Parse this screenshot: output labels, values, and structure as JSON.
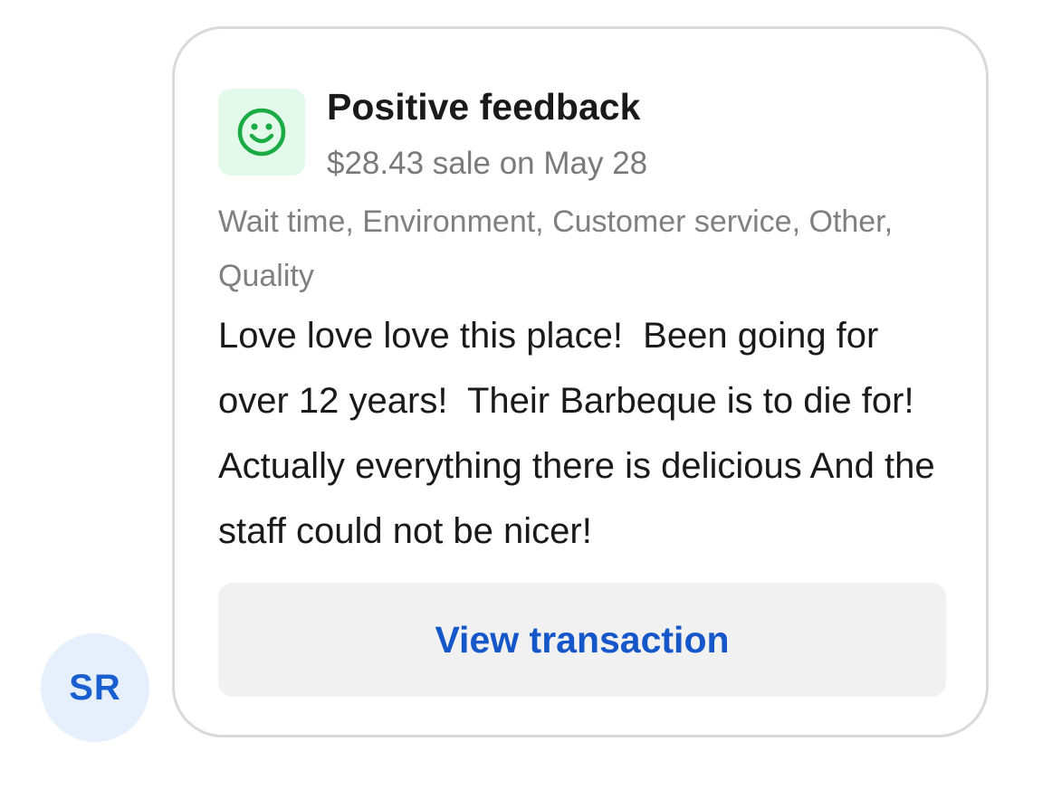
{
  "avatar": {
    "initials": "SR",
    "color": "#1a5fd0",
    "background": "#e6f0fd"
  },
  "feedback_card": {
    "icon": "smiley-face-icon",
    "icon_color": "#1aab45",
    "icon_background": "#e3f9ea",
    "title": "Positive feedback",
    "subtitle": "$28.43 sale on May 28",
    "tags": "Wait time, Environment, Customer service, Other, Quality",
    "review_text": "Love love love this place!  Been going for over 12 years!  Their Barbeque is to die for!  Actually everything there is delicious And the staff could not be nicer!",
    "action_label": "View transaction",
    "action_color": "#1556c9"
  }
}
